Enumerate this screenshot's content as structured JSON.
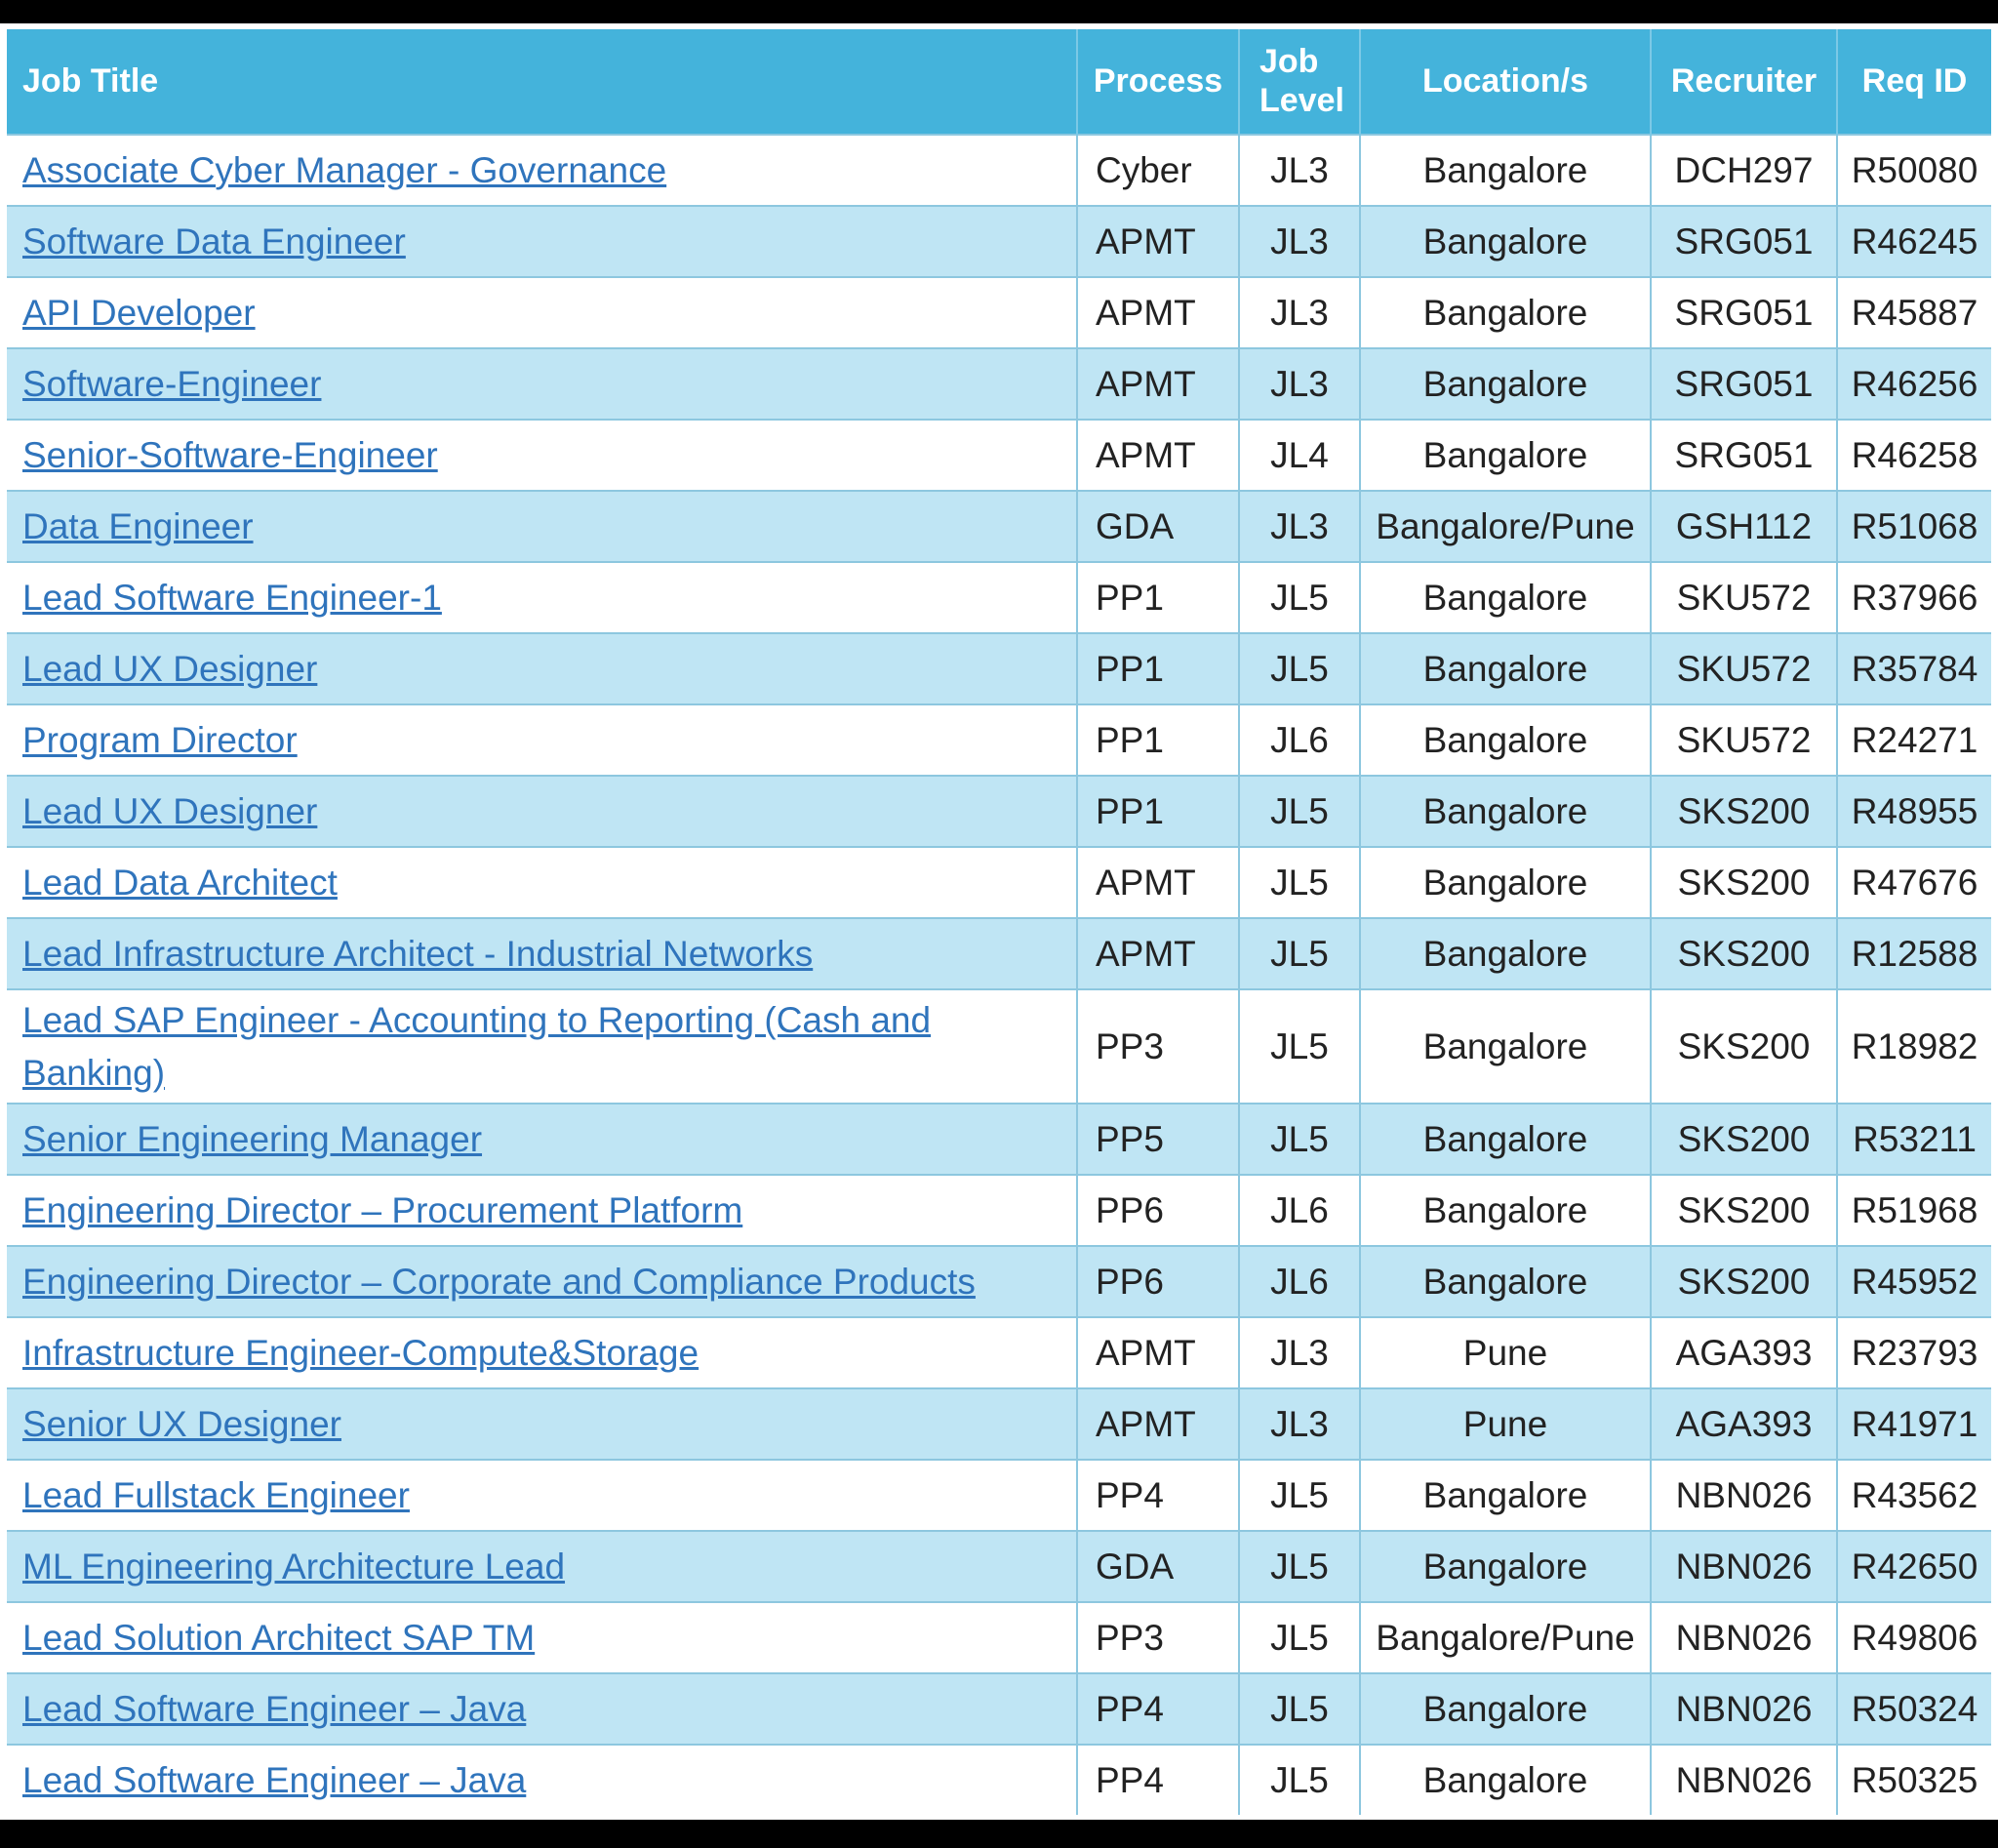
{
  "table": {
    "headers": {
      "job_title": "Job Title",
      "process": "Process",
      "job_level": "Job Level",
      "location": "Location/s",
      "recruiter": "Recruiter",
      "req_id": "Req ID"
    },
    "rows": [
      {
        "title": "Associate Cyber Manager - Governance",
        "process": "Cyber",
        "level": "JL3",
        "location": "Bangalore",
        "recruiter": "DCH297",
        "req_id": "R50080"
      },
      {
        "title": "Software Data Engineer",
        "process": "APMT",
        "level": "JL3",
        "location": "Bangalore",
        "recruiter": "SRG051",
        "req_id": "R46245"
      },
      {
        "title": "API Developer",
        "process": "APMT",
        "level": "JL3",
        "location": "Bangalore",
        "recruiter": "SRG051",
        "req_id": "R45887"
      },
      {
        "title": "Software-Engineer",
        "process": "APMT",
        "level": "JL3",
        "location": "Bangalore",
        "recruiter": "SRG051",
        "req_id": "R46256"
      },
      {
        "title": "Senior-Software-Engineer",
        "process": "APMT",
        "level": "JL4",
        "location": "Bangalore",
        "recruiter": "SRG051",
        "req_id": "R46258"
      },
      {
        "title": "Data Engineer",
        "process": "GDA",
        "level": "JL3",
        "location": "Bangalore/Pune",
        "recruiter": "GSH112",
        "req_id": "R51068"
      },
      {
        "title": "Lead Software Engineer-1",
        "process": "PP1",
        "level": "JL5",
        "location": "Bangalore",
        "recruiter": "SKU572",
        "req_id": "R37966"
      },
      {
        "title": "Lead UX Designer",
        "process": "PP1",
        "level": "JL5",
        "location": "Bangalore",
        "recruiter": "SKU572",
        "req_id": "R35784"
      },
      {
        "title": "Program Director",
        "process": "PP1",
        "level": "JL6",
        "location": "Bangalore",
        "recruiter": "SKU572",
        "req_id": "R24271"
      },
      {
        "title": "Lead UX Designer",
        "process": "PP1",
        "level": "JL5",
        "location": "Bangalore",
        "recruiter": "SKS200",
        "req_id": "R48955"
      },
      {
        "title": "Lead Data Architect",
        "process": "APMT",
        "level": "JL5",
        "location": "Bangalore",
        "recruiter": "SKS200",
        "req_id": "R47676"
      },
      {
        "title": "Lead Infrastructure Architect - Industrial Networks",
        "process": "APMT",
        "level": "JL5",
        "location": "Bangalore",
        "recruiter": "SKS200",
        "req_id": "R12588"
      },
      {
        "title": "Lead SAP Engineer - Accounting to Reporting (Cash and Banking)",
        "process": "PP3",
        "level": "JL5",
        "location": "Bangalore",
        "recruiter": "SKS200",
        "req_id": "R18982"
      },
      {
        "title": "Senior Engineering Manager",
        "process": "PP5",
        "level": "JL5",
        "location": "Bangalore",
        "recruiter": "SKS200",
        "req_id": "R53211"
      },
      {
        "title": "Engineering Director – Procurement Platform",
        "process": "PP6",
        "level": "JL6",
        "location": "Bangalore",
        "recruiter": "SKS200",
        "req_id": "R51968"
      },
      {
        "title": "Engineering Director – Corporate and Compliance Products",
        "process": "PP6",
        "level": "JL6",
        "location": "Bangalore",
        "recruiter": "SKS200",
        "req_id": "R45952"
      },
      {
        "title": "Infrastructure Engineer-Compute&Storage",
        "process": "APMT",
        "level": "JL3",
        "location": "Pune",
        "recruiter": "AGA393",
        "req_id": "R23793"
      },
      {
        "title": "Senior UX Designer",
        "process": "APMT",
        "level": "JL3",
        "location": "Pune",
        "recruiter": "AGA393",
        "req_id": "R41971"
      },
      {
        "title": "Lead Fullstack Engineer",
        "process": "PP4",
        "level": "JL5",
        "location": "Bangalore",
        "recruiter": "NBN026",
        "req_id": "R43562"
      },
      {
        "title": "ML Engineering Architecture Lead",
        "process": "GDA",
        "level": "JL5",
        "location": "Bangalore",
        "recruiter": "NBN026",
        "req_id": "R42650"
      },
      {
        "title": "Lead Solution Architect SAP TM",
        "process": "PP3",
        "level": "JL5",
        "location": "Bangalore/Pune",
        "recruiter": "NBN026",
        "req_id": "R49806"
      },
      {
        "title": "Lead Software Engineer – Java",
        "process": "PP4",
        "level": "JL5",
        "location": "Bangalore",
        "recruiter": "NBN026",
        "req_id": "R50324"
      },
      {
        "title": "Lead Software Engineer – Java",
        "process": "PP4",
        "level": "JL5",
        "location": "Bangalore",
        "recruiter": "NBN026",
        "req_id": "R50325"
      }
    ]
  }
}
